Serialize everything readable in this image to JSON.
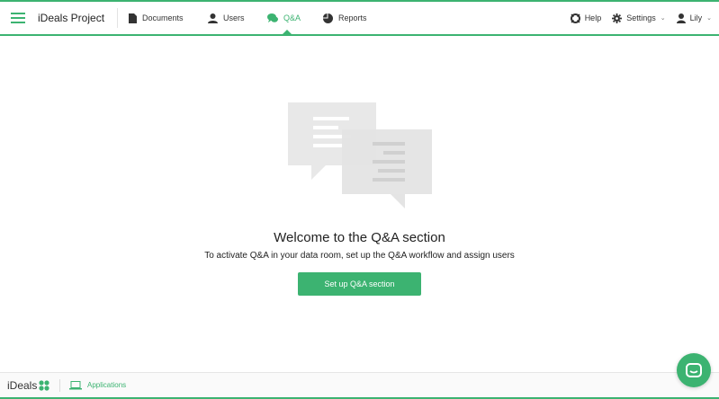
{
  "header": {
    "project_title": "iDeals Project",
    "nav": [
      {
        "label": "Documents",
        "icon": "document-icon"
      },
      {
        "label": "Users",
        "icon": "user-icon"
      },
      {
        "label": "Q&A",
        "icon": "chat-icon",
        "active": true
      },
      {
        "label": "Reports",
        "icon": "pie-chart-icon"
      }
    ],
    "help_label": "Help",
    "settings_label": "Settings",
    "user_label": "Lily"
  },
  "main": {
    "welcome_title": "Welcome to the Q&A section",
    "subtitle": "To activate Q&A in your data room, set up the Q&A workflow and assign users",
    "setup_button_label": "Set up Q&A section"
  },
  "footer": {
    "brand": "iDeals",
    "applications_label": "Applications"
  },
  "colors": {
    "accent": "#3cb371",
    "illustration": "#e9e9e9"
  }
}
